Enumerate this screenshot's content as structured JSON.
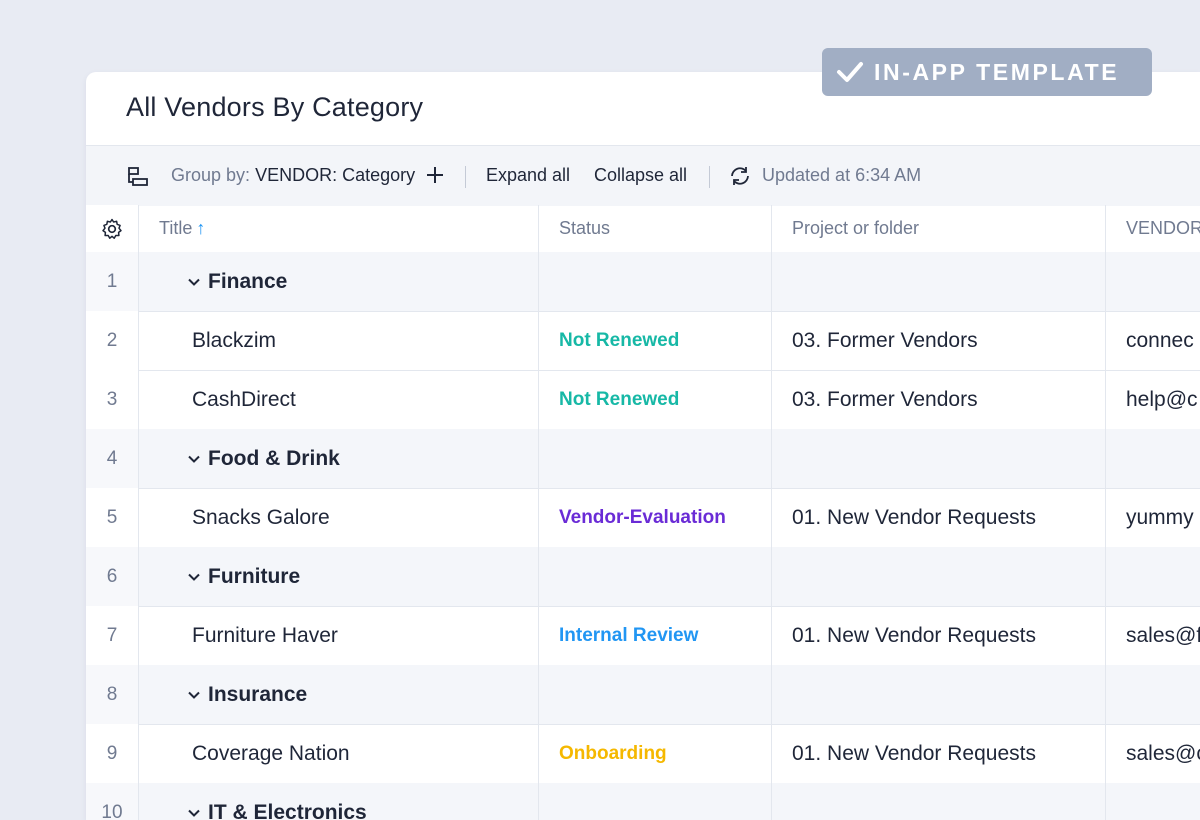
{
  "badge": {
    "label": "IN-APP TEMPLATE",
    "icon": "checkmark-icon"
  },
  "view": {
    "title": "All Vendors By Category"
  },
  "toolbar": {
    "group_by_label": "Group by:",
    "group_by_value": "VENDOR: Category",
    "expand_all": "Expand all",
    "collapse_all": "Collapse all",
    "updated": "Updated at 6:34 AM"
  },
  "table": {
    "columns": {
      "title": "Title",
      "status": "Status",
      "project": "Project or folder",
      "vendor": "VENDOR"
    },
    "rows": [
      {
        "num": "1",
        "type": "group",
        "title": "Finance"
      },
      {
        "num": "2",
        "type": "item",
        "title": "Blackzim",
        "status": "Not Renewed",
        "status_color": "#17b8a6",
        "project": "03. Former Vendors",
        "email": "connec"
      },
      {
        "num": "3",
        "type": "item",
        "title": "CashDirect",
        "status": "Not Renewed",
        "status_color": "#17b8a6",
        "project": "03. Former Vendors",
        "email": "help@c"
      },
      {
        "num": "4",
        "type": "group",
        "title": "Food & Drink"
      },
      {
        "num": "5",
        "type": "item",
        "title": "Snacks Galore",
        "status": "Vendor-Evaluation",
        "status_color": "#6a2bd6",
        "project": "01. New Vendor Requests",
        "email": "yummy"
      },
      {
        "num": "6",
        "type": "group",
        "title": "Furniture"
      },
      {
        "num": "7",
        "type": "item",
        "title": "Furniture Haver",
        "status": "Internal Review",
        "status_color": "#2196f3",
        "project": "01. New Vendor Requests",
        "email": "sales@f"
      },
      {
        "num": "8",
        "type": "group",
        "title": "Insurance"
      },
      {
        "num": "9",
        "type": "item",
        "title": "Coverage Nation",
        "status": "Onboarding",
        "status_color": "#f5b800",
        "project": "01. New Vendor Requests",
        "email": "sales@c"
      },
      {
        "num": "10",
        "type": "group",
        "title": "IT & Electronics"
      }
    ]
  },
  "colors": {
    "sort_arrow": "#2196f3",
    "badge_bg": "#a1aec4",
    "background": "#e8ebf3"
  }
}
